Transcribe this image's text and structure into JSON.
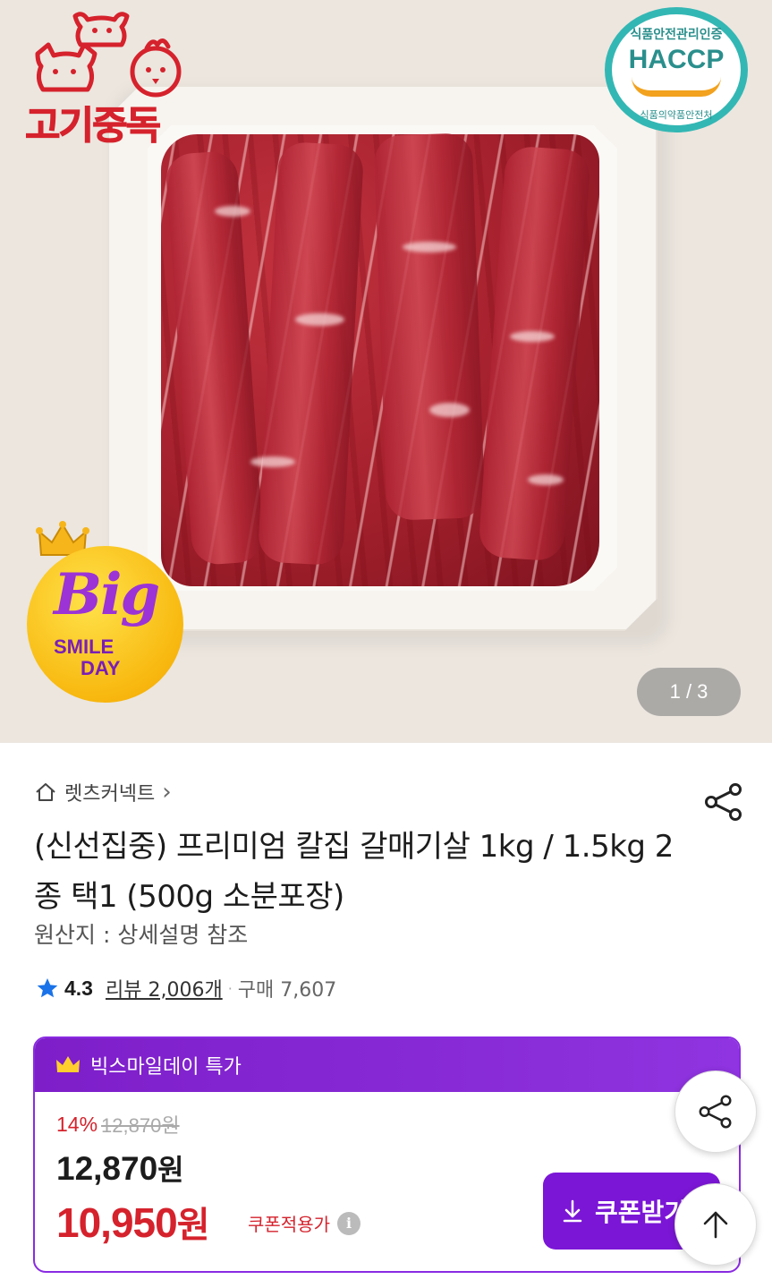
{
  "hero": {
    "brand_text": "고기중독",
    "haccp": {
      "top_text": "식품안전관리인증",
      "title": "HACCP",
      "bottom_text": "식품의약품안전처"
    },
    "promo_badge": {
      "big": "Big",
      "smile": "SMILE",
      "day": "DAY"
    },
    "page_counter": "1 / 3"
  },
  "store": {
    "name": "렛츠커넥트",
    "chevron": "›",
    "home_icon": "home-outline-icon",
    "share_icon": "share-icon"
  },
  "product": {
    "title": "(신선집중) 프리미엄 칼집 갈매기살 1kg / 1.5kg 2종 택1 (500g 소분포장)",
    "origin": "원산지 : 상세설명 참조",
    "rating": "4.3",
    "review_text": "리뷰 2,006개",
    "separator": "·",
    "purchase_text": "구매 7,607"
  },
  "deal": {
    "header_label": "빅스마일데이 특가",
    "discount_pct": "14%",
    "original_price": "12,870원",
    "sale_price_number": "12,870",
    "sale_price_unit": "원",
    "coupon_price_number": "10,950",
    "coupon_price_unit": "원",
    "coupon_label": "쿠폰적용가",
    "info_symbol": "i",
    "coupon_button": "쿠폰받기"
  },
  "colors": {
    "accent_purple": "#7b16d6",
    "price_red": "#d5222c",
    "star_blue": "#1a73e8"
  }
}
